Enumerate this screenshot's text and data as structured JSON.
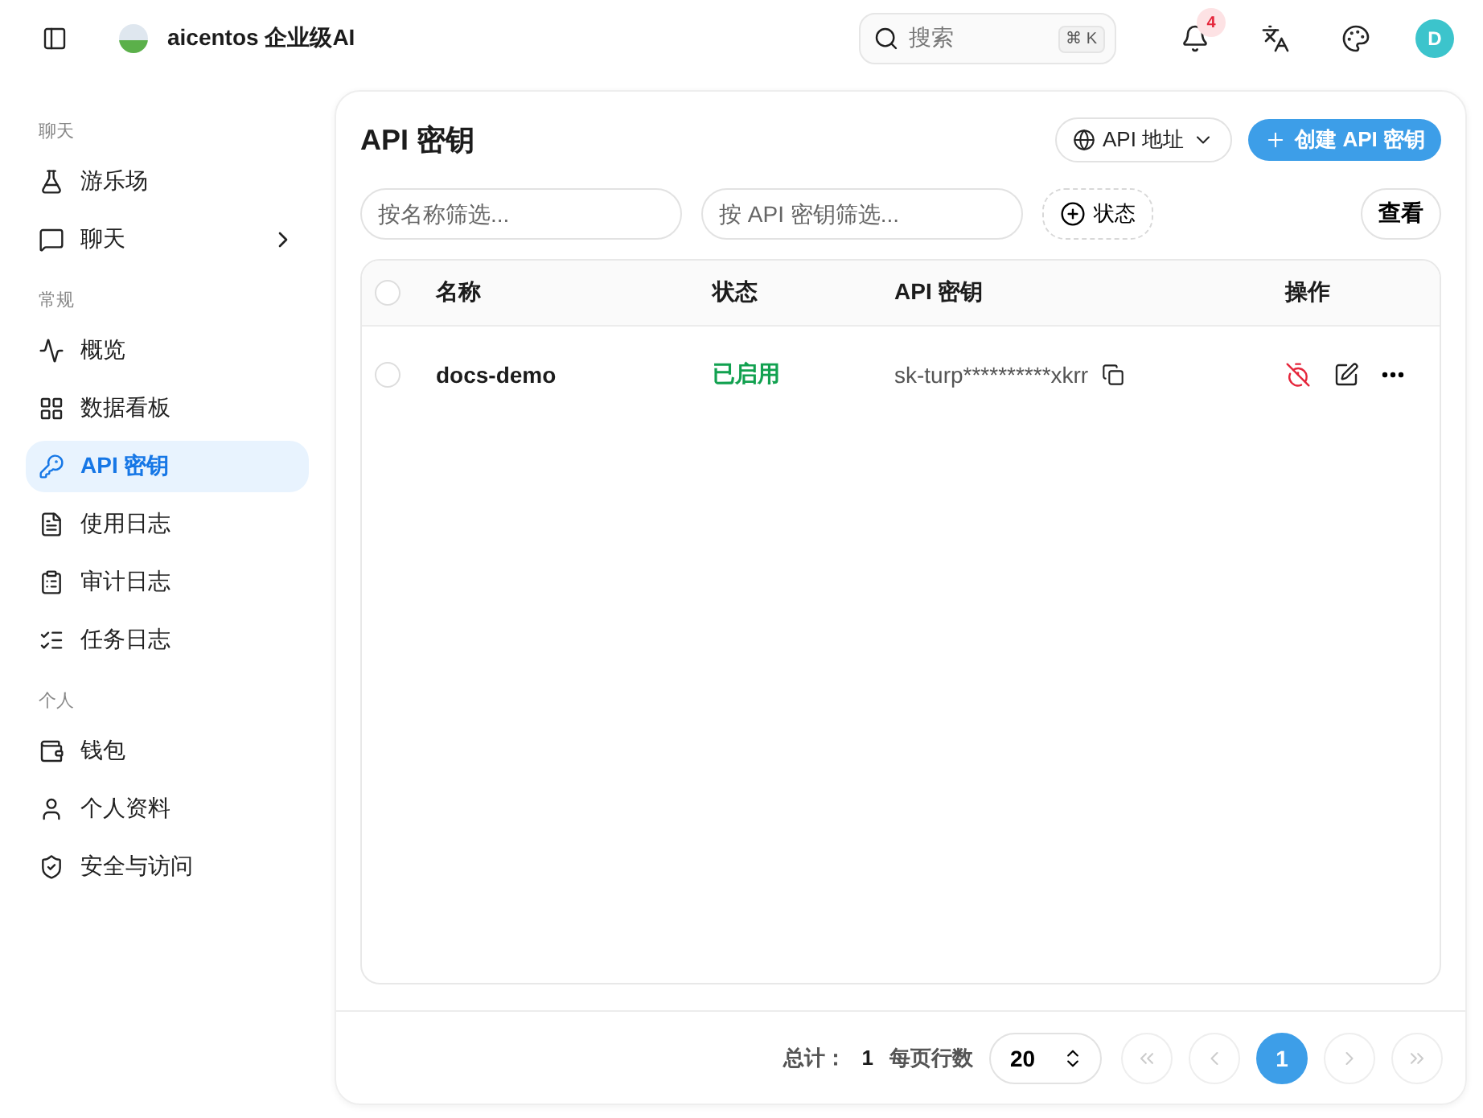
{
  "header": {
    "app_name": "aicentos 企业级AI",
    "search": {
      "placeholder": "搜索",
      "shortcut": "⌘ K"
    },
    "notifications": {
      "count": "4"
    },
    "avatar": "D"
  },
  "sidebar": {
    "sections": [
      {
        "title": "聊天",
        "items": [
          {
            "label": "游乐场",
            "selected": false
          },
          {
            "label": "聊天",
            "selected": false,
            "expanded": false
          }
        ]
      },
      {
        "title": "常规",
        "items": [
          {
            "label": "概览",
            "selected": false
          },
          {
            "label": "数据看板",
            "selected": false
          },
          {
            "label": "API 密钥",
            "selected": true
          },
          {
            "label": "使用日志",
            "selected": false
          },
          {
            "label": "审计日志",
            "selected": false
          },
          {
            "label": "任务日志",
            "selected": false
          }
        ]
      },
      {
        "title": "个人",
        "items": [
          {
            "label": "钱包",
            "selected": false
          },
          {
            "label": "个人资料",
            "selected": false
          },
          {
            "label": "安全与访问",
            "selected": false
          }
        ]
      }
    ]
  },
  "page": {
    "title": "API 密钥",
    "api_address_button": "API 地址",
    "create_button": "创建 API 密钥",
    "filters": {
      "name_placeholder": "按名称筛选...",
      "key_placeholder": "按 API 密钥筛选...",
      "status_filter": "状态",
      "view_button": "查看"
    },
    "table": {
      "columns": [
        "名称",
        "状态",
        "API 密钥",
        "操作"
      ],
      "all_selected": false,
      "rows": [
        {
          "name": "docs-demo",
          "status": "已启用",
          "enabled": true,
          "key": "sk-turp**********xkrr",
          "selected": false
        }
      ]
    },
    "pagination": {
      "total_label": "总计：",
      "total": "1",
      "page_size_label": "每页行数",
      "page_size": "20",
      "pages": [
        {
          "label": "1",
          "selected": true
        }
      ]
    }
  }
}
